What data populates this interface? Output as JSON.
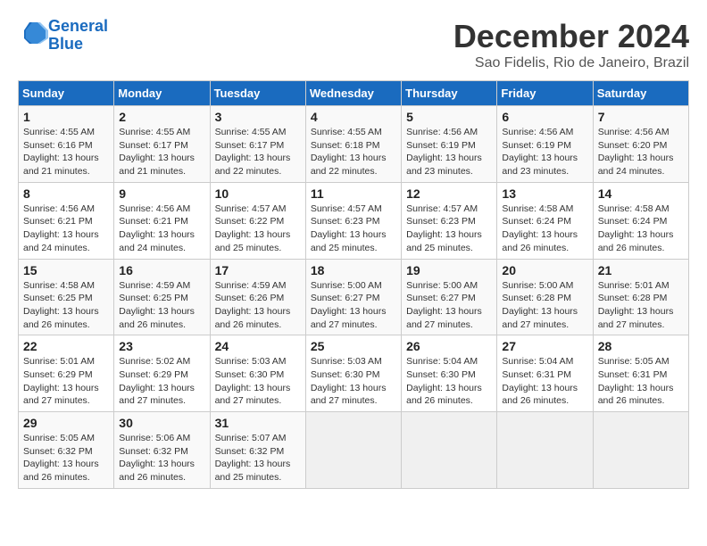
{
  "logo": {
    "line1": "General",
    "line2": "Blue"
  },
  "title": "December 2024",
  "subtitle": "Sao Fidelis, Rio de Janeiro, Brazil",
  "weekdays": [
    "Sunday",
    "Monday",
    "Tuesday",
    "Wednesday",
    "Thursday",
    "Friday",
    "Saturday"
  ],
  "weeks": [
    [
      {
        "day": "1",
        "sunrise": "4:55 AM",
        "sunset": "6:16 PM",
        "daylight": "13 hours and 21 minutes."
      },
      {
        "day": "2",
        "sunrise": "4:55 AM",
        "sunset": "6:17 PM",
        "daylight": "13 hours and 21 minutes."
      },
      {
        "day": "3",
        "sunrise": "4:55 AM",
        "sunset": "6:17 PM",
        "daylight": "13 hours and 22 minutes."
      },
      {
        "day": "4",
        "sunrise": "4:55 AM",
        "sunset": "6:18 PM",
        "daylight": "13 hours and 22 minutes."
      },
      {
        "day": "5",
        "sunrise": "4:56 AM",
        "sunset": "6:19 PM",
        "daylight": "13 hours and 23 minutes."
      },
      {
        "day": "6",
        "sunrise": "4:56 AM",
        "sunset": "6:19 PM",
        "daylight": "13 hours and 23 minutes."
      },
      {
        "day": "7",
        "sunrise": "4:56 AM",
        "sunset": "6:20 PM",
        "daylight": "13 hours and 24 minutes."
      }
    ],
    [
      {
        "day": "8",
        "sunrise": "4:56 AM",
        "sunset": "6:21 PM",
        "daylight": "13 hours and 24 minutes."
      },
      {
        "day": "9",
        "sunrise": "4:56 AM",
        "sunset": "6:21 PM",
        "daylight": "13 hours and 24 minutes."
      },
      {
        "day": "10",
        "sunrise": "4:57 AM",
        "sunset": "6:22 PM",
        "daylight": "13 hours and 25 minutes."
      },
      {
        "day": "11",
        "sunrise": "4:57 AM",
        "sunset": "6:23 PM",
        "daylight": "13 hours and 25 minutes."
      },
      {
        "day": "12",
        "sunrise": "4:57 AM",
        "sunset": "6:23 PM",
        "daylight": "13 hours and 25 minutes."
      },
      {
        "day": "13",
        "sunrise": "4:58 AM",
        "sunset": "6:24 PM",
        "daylight": "13 hours and 26 minutes."
      },
      {
        "day": "14",
        "sunrise": "4:58 AM",
        "sunset": "6:24 PM",
        "daylight": "13 hours and 26 minutes."
      }
    ],
    [
      {
        "day": "15",
        "sunrise": "4:58 AM",
        "sunset": "6:25 PM",
        "daylight": "13 hours and 26 minutes."
      },
      {
        "day": "16",
        "sunrise": "4:59 AM",
        "sunset": "6:25 PM",
        "daylight": "13 hours and 26 minutes."
      },
      {
        "day": "17",
        "sunrise": "4:59 AM",
        "sunset": "6:26 PM",
        "daylight": "13 hours and 26 minutes."
      },
      {
        "day": "18",
        "sunrise": "5:00 AM",
        "sunset": "6:27 PM",
        "daylight": "13 hours and 27 minutes."
      },
      {
        "day": "19",
        "sunrise": "5:00 AM",
        "sunset": "6:27 PM",
        "daylight": "13 hours and 27 minutes."
      },
      {
        "day": "20",
        "sunrise": "5:00 AM",
        "sunset": "6:28 PM",
        "daylight": "13 hours and 27 minutes."
      },
      {
        "day": "21",
        "sunrise": "5:01 AM",
        "sunset": "6:28 PM",
        "daylight": "13 hours and 27 minutes."
      }
    ],
    [
      {
        "day": "22",
        "sunrise": "5:01 AM",
        "sunset": "6:29 PM",
        "daylight": "13 hours and 27 minutes."
      },
      {
        "day": "23",
        "sunrise": "5:02 AM",
        "sunset": "6:29 PM",
        "daylight": "13 hours and 27 minutes."
      },
      {
        "day": "24",
        "sunrise": "5:03 AM",
        "sunset": "6:30 PM",
        "daylight": "13 hours and 27 minutes."
      },
      {
        "day": "25",
        "sunrise": "5:03 AM",
        "sunset": "6:30 PM",
        "daylight": "13 hours and 27 minutes."
      },
      {
        "day": "26",
        "sunrise": "5:04 AM",
        "sunset": "6:30 PM",
        "daylight": "13 hours and 26 minutes."
      },
      {
        "day": "27",
        "sunrise": "5:04 AM",
        "sunset": "6:31 PM",
        "daylight": "13 hours and 26 minutes."
      },
      {
        "day": "28",
        "sunrise": "5:05 AM",
        "sunset": "6:31 PM",
        "daylight": "13 hours and 26 minutes."
      }
    ],
    [
      {
        "day": "29",
        "sunrise": "5:05 AM",
        "sunset": "6:32 PM",
        "daylight": "13 hours and 26 minutes."
      },
      {
        "day": "30",
        "sunrise": "5:06 AM",
        "sunset": "6:32 PM",
        "daylight": "13 hours and 26 minutes."
      },
      {
        "day": "31",
        "sunrise": "5:07 AM",
        "sunset": "6:32 PM",
        "daylight": "13 hours and 25 minutes."
      },
      null,
      null,
      null,
      null
    ]
  ]
}
